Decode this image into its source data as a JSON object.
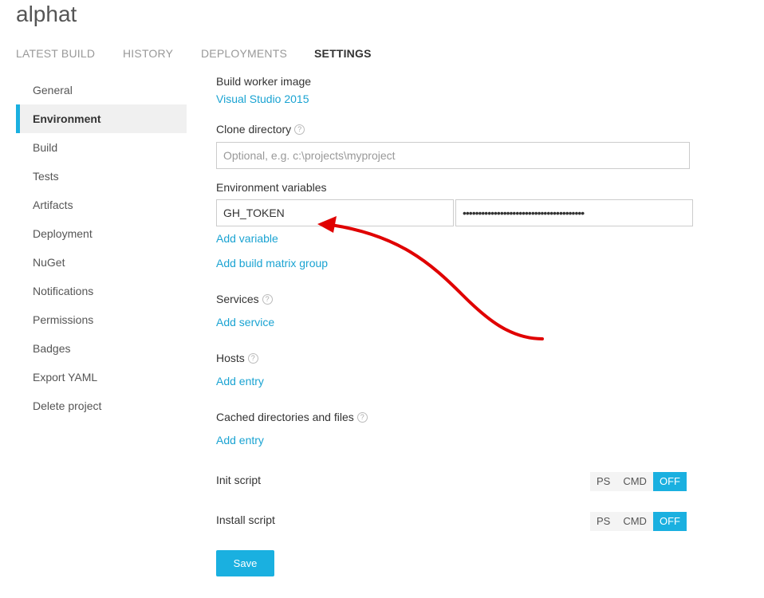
{
  "project": {
    "title": "alphat"
  },
  "tabs": [
    {
      "label": "LATEST BUILD"
    },
    {
      "label": "HISTORY"
    },
    {
      "label": "DEPLOYMENTS"
    },
    {
      "label": "SETTINGS"
    }
  ],
  "sidebar": {
    "items": [
      {
        "label": "General"
      },
      {
        "label": "Environment"
      },
      {
        "label": "Build"
      },
      {
        "label": "Tests"
      },
      {
        "label": "Artifacts"
      },
      {
        "label": "Deployment"
      },
      {
        "label": "NuGet"
      },
      {
        "label": "Notifications"
      },
      {
        "label": "Permissions"
      },
      {
        "label": "Badges"
      },
      {
        "label": "Export YAML"
      },
      {
        "label": "Delete project"
      }
    ]
  },
  "settings": {
    "worker_image_label": "Build worker image",
    "worker_image_value": "Visual Studio 2015",
    "clone_dir_label": "Clone directory",
    "clone_dir_placeholder": "Optional, e.g. c:\\projects\\myproject",
    "env_vars_label": "Environment variables",
    "env_var_name": "GH_TOKEN",
    "env_var_value_masked": "•••••••••••••••••••••••••••••••••••••••",
    "add_variable": "Add variable",
    "add_matrix_group": "Add build matrix group",
    "services_label": "Services",
    "add_service": "Add service",
    "hosts_label": "Hosts",
    "add_host_entry": "Add entry",
    "cache_label": "Cached directories and files",
    "add_cache_entry": "Add entry",
    "init_script_label": "Init script",
    "install_script_label": "Install script",
    "script_options": {
      "ps": "PS",
      "cmd": "CMD",
      "off": "OFF"
    },
    "save_label": "Save",
    "help_glyph": "?"
  },
  "colors": {
    "accent": "#1ab0e0",
    "link": "#1aa3d2",
    "annotation_arrow": "#e00000"
  }
}
